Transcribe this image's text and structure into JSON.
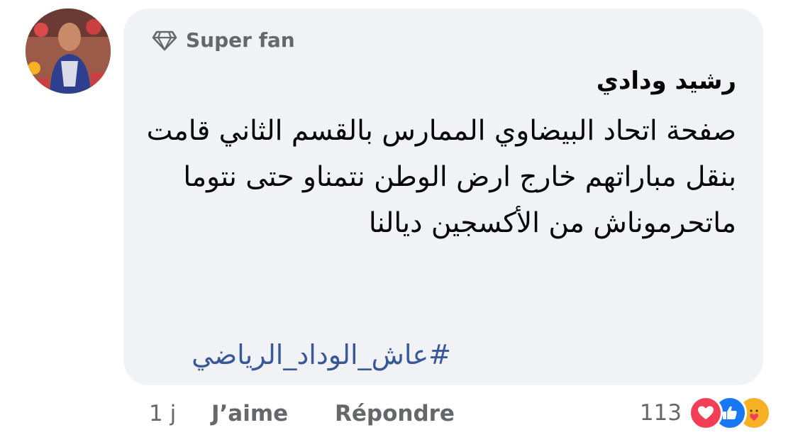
{
  "comment": {
    "author_name": "رشيد ودادي",
    "badge_label": "Super fan",
    "badge_icon": "diamond-icon",
    "text": "صفحة اتحاد البيضاوي الممارس بالقسم الثاني  قامت بنقل مباراتهم خارج ارض الوطن نتمناو حتى نتوما ماتحرموناش من الأكسجين ديالنا",
    "hashtag": "#عاش_الوداد_الرياضي",
    "hashtag_color": "#385898",
    "bubble_color": "#f0f2f5"
  },
  "actions": {
    "time": "1 j",
    "like_label": "J’aime",
    "reply_label": "Répondre"
  },
  "reactions": {
    "count": "113",
    "types": [
      "love",
      "like",
      "care"
    ],
    "colors": {
      "love": "#f33e58",
      "like": "#1877f2",
      "care": "#f7b125"
    }
  }
}
